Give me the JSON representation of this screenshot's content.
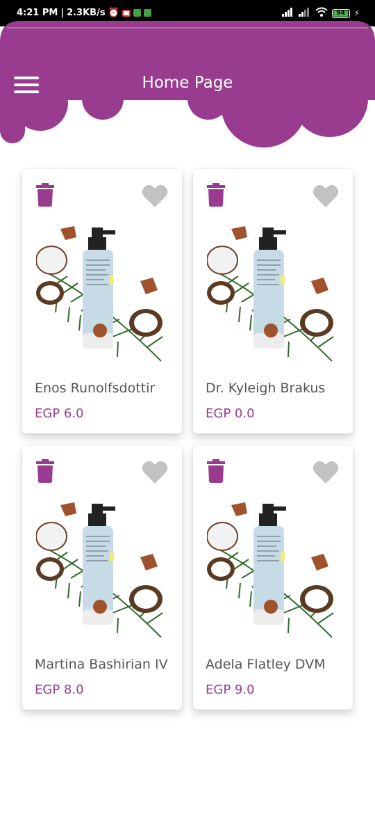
{
  "status_bar": {
    "time": "4:21 PM",
    "speed": "2.3KB/s",
    "battery": "94"
  },
  "header": {
    "title": "Home Page",
    "menu_icon": "hamburger-menu-icon"
  },
  "theme": {
    "accent": "#993c8f",
    "heart_inactive": "#c2c2c2"
  },
  "products": [
    {
      "name": "Enos Runolfsdottir",
      "price": "EGP 6.0"
    },
    {
      "name": "Dr. Kyleigh Brakus",
      "price": "EGP 0.0"
    },
    {
      "name": "Martina Bashirian IV",
      "price": "EGP 8.0"
    },
    {
      "name": "Adela Flatley DVM",
      "price": "EGP 9.0"
    }
  ]
}
